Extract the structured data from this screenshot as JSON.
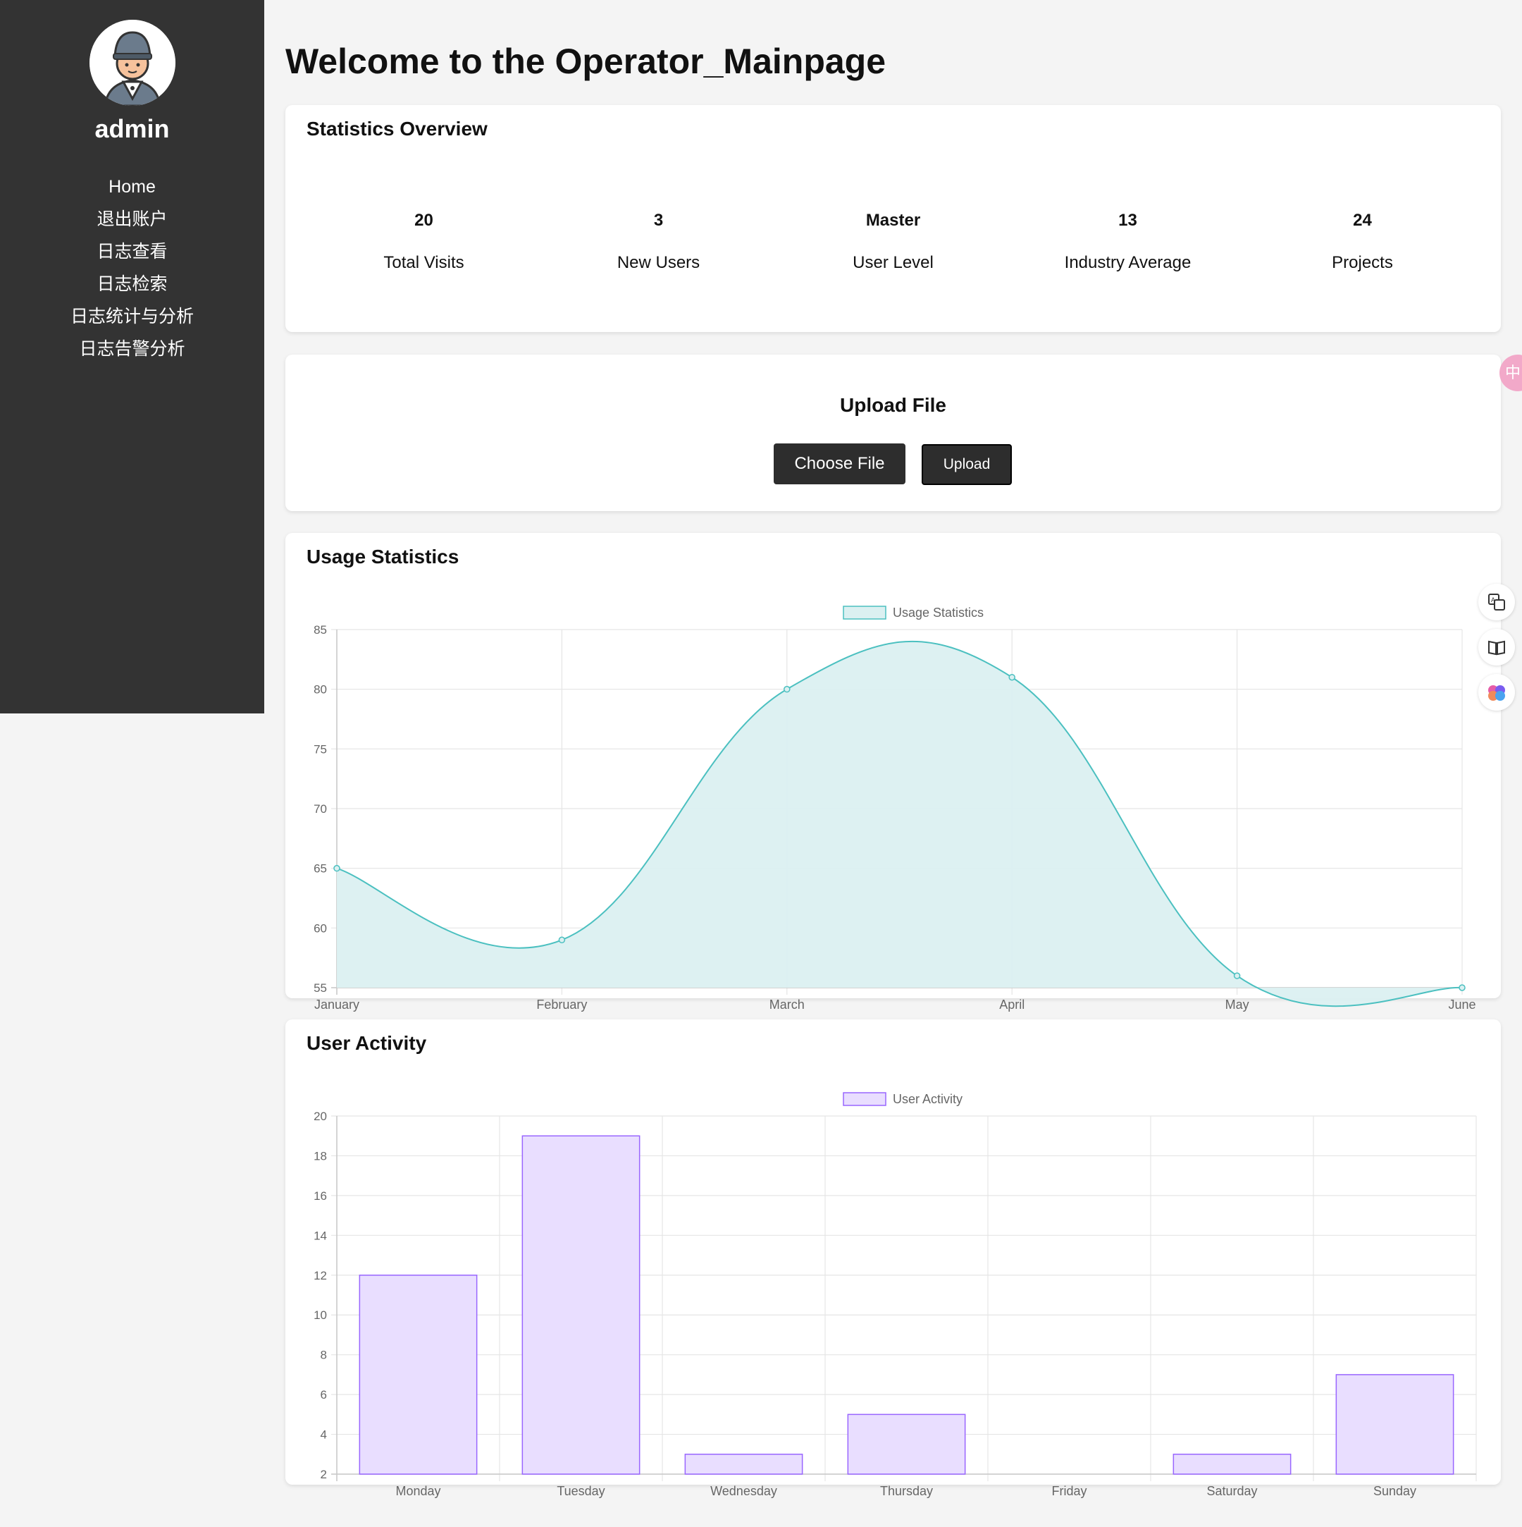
{
  "sidebar": {
    "username": "admin",
    "nav": [
      "Home",
      "退出账户",
      "日志查看",
      "日志检索",
      "日志统计与分析",
      "日志告警分析"
    ]
  },
  "page_title": "Welcome to the Operator_Mainpage",
  "stats": {
    "title": "Statistics Overview",
    "items": [
      {
        "value": "20",
        "label": "Total Visits"
      },
      {
        "value": "3",
        "label": "New Users"
      },
      {
        "value": "Master",
        "label": "User Level"
      },
      {
        "value": "13",
        "label": "Industry Average"
      },
      {
        "value": "24",
        "label": "Projects"
      }
    ]
  },
  "upload": {
    "title": "Upload File",
    "choose_label": "Choose File",
    "upload_label": "Upload"
  },
  "side_badge": "中",
  "icons": [
    "translate-icon",
    "reader-icon",
    "brain-icon"
  ],
  "chart_data": [
    {
      "type": "area",
      "title": "Usage Statistics",
      "categories": [
        "January",
        "February",
        "March",
        "April",
        "May",
        "June"
      ],
      "series": [
        {
          "name": "Usage Statistics",
          "values": [
            65,
            59,
            80,
            81,
            56,
            55
          ]
        }
      ],
      "ylim": [
        55,
        85
      ],
      "yticks": [
        55,
        60,
        65,
        70,
        75,
        80,
        85
      ],
      "grid": true,
      "legend": "top-center",
      "colors": {
        "line": "#4bc0c0",
        "fill": "#dbf0f1"
      }
    },
    {
      "type": "bar",
      "title": "User Activity",
      "categories": [
        "Monday",
        "Tuesday",
        "Wednesday",
        "Thursday",
        "Friday",
        "Saturday",
        "Sunday"
      ],
      "series": [
        {
          "name": "User Activity",
          "values": [
            12,
            19,
            3,
            5,
            2,
            3,
            7
          ]
        }
      ],
      "ylim": [
        2,
        20
      ],
      "yticks": [
        2,
        4,
        6,
        8,
        10,
        12,
        14,
        16,
        18,
        20
      ],
      "grid": true,
      "legend": "top-center",
      "colors": {
        "line": "#9966ff",
        "fill": "#e9deff"
      }
    }
  ]
}
